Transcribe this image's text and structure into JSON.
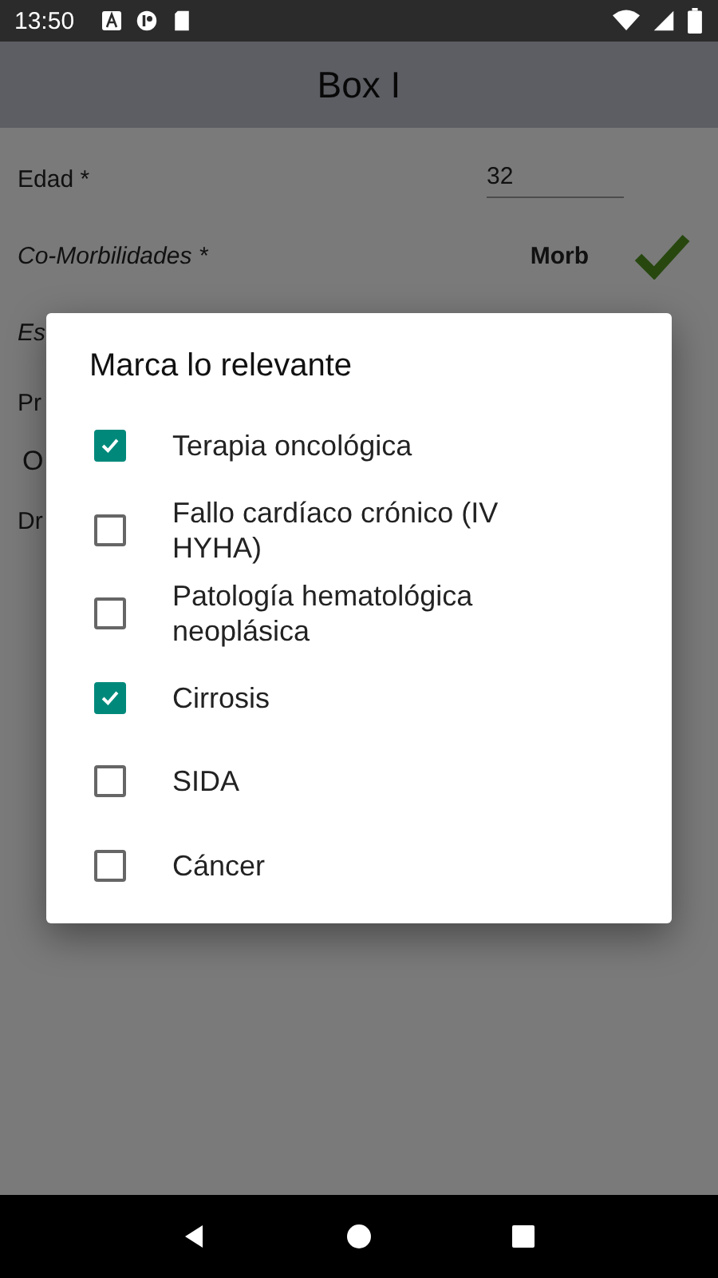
{
  "status_bar": {
    "time": "13:50"
  },
  "app_bar": {
    "title": "Box I"
  },
  "form": {
    "fields": [
      {
        "kind": "input",
        "label": "Edad *",
        "value": "32"
      },
      {
        "kind": "picker",
        "label": "Co-Morbilidades *",
        "value": "Morb"
      },
      {
        "kind": "italic",
        "label": "Es"
      },
      {
        "kind": "plain",
        "label": "Pr"
      },
      {
        "kind": "option",
        "label": "O"
      },
      {
        "kind": "plain",
        "label": "Dr"
      }
    ]
  },
  "dialog": {
    "title": "Marca lo relevante",
    "items": [
      {
        "label": "Terapia oncológica",
        "checked": true
      },
      {
        "label": "Fallo cardíaco crónico (IV HYHA)",
        "checked": false
      },
      {
        "label": "Patología hematológica neoplásica",
        "checked": false
      },
      {
        "label": "Cirrosis",
        "checked": true
      },
      {
        "label": "SIDA",
        "checked": false
      },
      {
        "label": "Cáncer",
        "checked": false
      }
    ]
  }
}
